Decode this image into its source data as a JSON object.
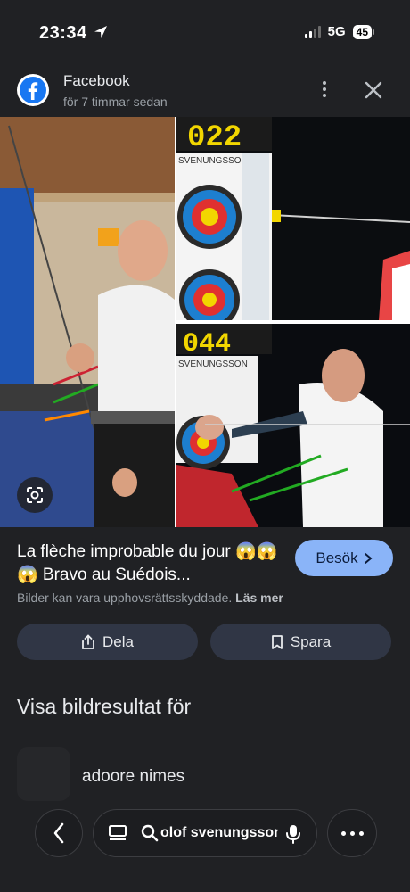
{
  "status": {
    "time": "23:34",
    "network": "5G",
    "battery": "45"
  },
  "source": {
    "name": "Facebook",
    "time": "för 7 timmar sedan"
  },
  "result": {
    "title": "La flèche improbable du jour 😱😱 😱 Bravo au Suédois...",
    "visit_label": "Besök",
    "copyright_text": "Bilder kan vara upphovsrättsskyddade.",
    "learn_more": "Läs mer",
    "share_label": "Dela",
    "save_label": "Spara"
  },
  "image": {
    "top_scoreboard": "022",
    "top_banner": "SVENUNGSSON",
    "bottom_scoreboard": "044",
    "bottom_banner": "SVENUNGSSON"
  },
  "related": {
    "heading": "Visa bildresultat för",
    "item_label": "adoore nimes"
  },
  "search": {
    "query": "olof svenungsson"
  },
  "icons": {
    "location": "location-arrow-icon",
    "facebook": "facebook-logo",
    "more": "more-vert-icon",
    "close": "close-icon",
    "lens": "lens-icon",
    "share": "share-icon",
    "save": "bookmark-icon",
    "back": "chevron-left-icon",
    "tabs": "tabs-icon",
    "search": "search-icon",
    "mic": "mic-icon",
    "menu": "more-horiz-icon"
  },
  "colors": {
    "background": "#202124",
    "accent": "#8ab4f8",
    "button": "#303645"
  }
}
